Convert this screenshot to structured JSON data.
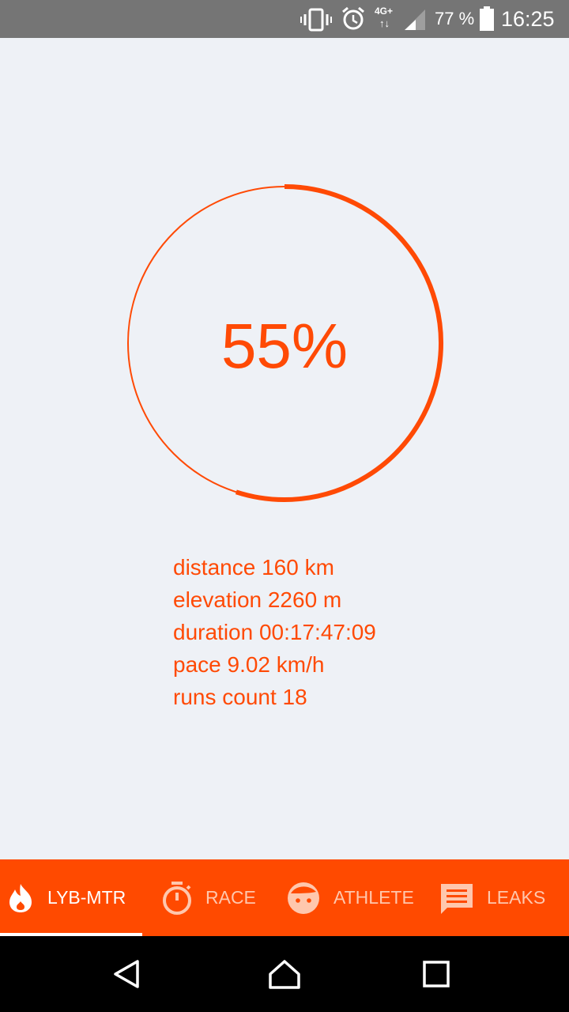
{
  "status_bar": {
    "network": "4G+",
    "network_arrows": "↑↓",
    "battery_percent": "77 %",
    "time": "16:25",
    "icons": [
      "vibrate-icon",
      "alarm-icon",
      "signal-icon",
      "battery-icon"
    ]
  },
  "progress": {
    "label": "55%",
    "fraction": 0.55
  },
  "stats": {
    "distance": "distance 160 km",
    "elevation": "elevation 2260 m",
    "duration": "duration 00:17:47:09",
    "pace": "pace 9.02 km/h",
    "runs_count": "runs count 18"
  },
  "tabs": [
    {
      "label": "LYB-MTR",
      "icon": "flame-icon",
      "active": true
    },
    {
      "label": "RACE",
      "icon": "stopwatch-icon",
      "active": false
    },
    {
      "label": "ATHLETE",
      "icon": "face-icon",
      "active": false
    },
    {
      "label": "LEAKS",
      "icon": "message-icon",
      "active": false
    }
  ],
  "colors": {
    "accent": "#ff4a05",
    "tabbar": "#ff4a00",
    "background": "#eef1f6",
    "status_bar": "#757575",
    "inactive_tab": "#ffc7ad"
  },
  "nav": [
    "back-icon",
    "home-icon",
    "recents-icon"
  ]
}
